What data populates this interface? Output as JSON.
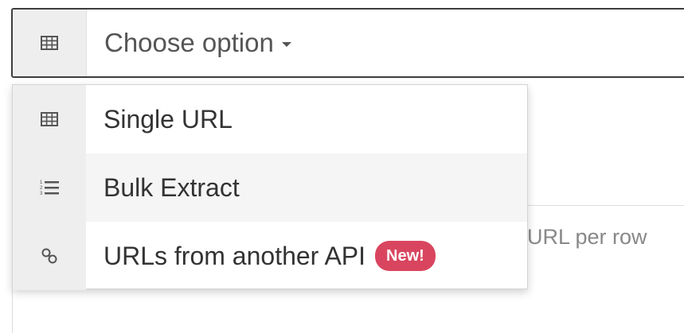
{
  "select": {
    "placeholder": "Choose option",
    "icon": "table-icon"
  },
  "menu": {
    "items": [
      {
        "label": "Single URL",
        "icon": "table-icon",
        "hovered": false
      },
      {
        "label": "Bulk Extract",
        "icon": "numbered-list-icon",
        "hovered": true
      },
      {
        "label": "URLs from another API",
        "icon": "link-icon",
        "badge": "New!",
        "hovered": false
      }
    ]
  },
  "background": {
    "partial_text": "URL per row"
  },
  "colors": {
    "badge": "#d9455f",
    "addon_bg": "#eeeeee",
    "hover_bg": "#f5f5f5"
  }
}
